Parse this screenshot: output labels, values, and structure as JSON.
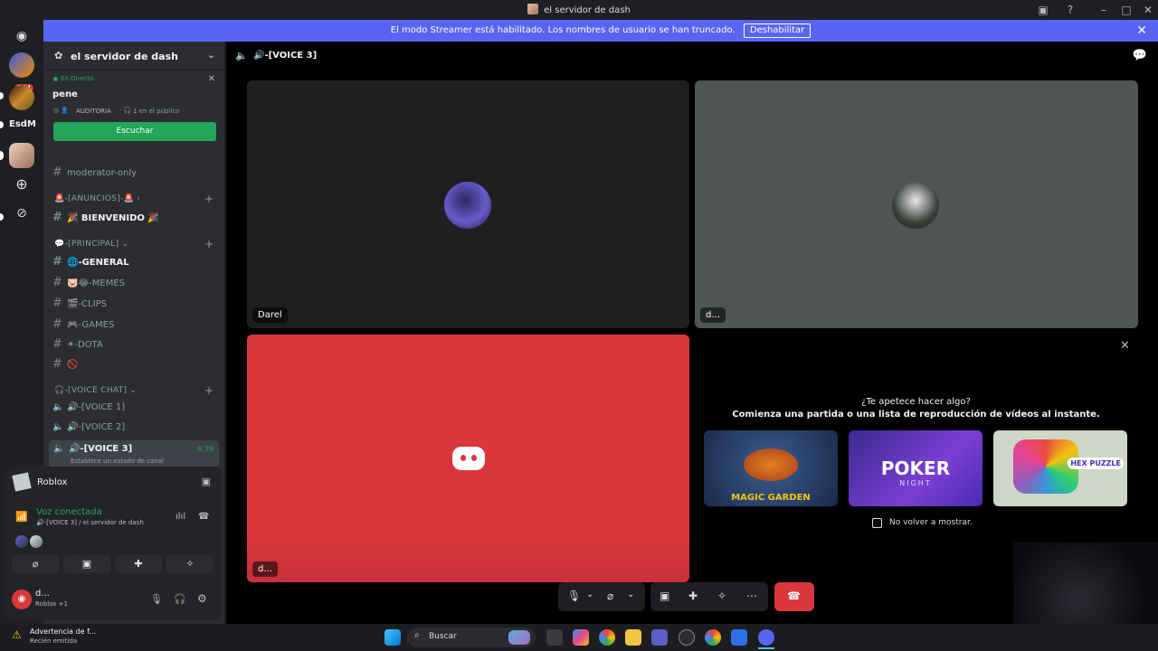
{
  "window": {
    "title": "el servidor de dash"
  },
  "banner": {
    "text": "El modo Streamer está habilitado. Los nombres de usuario se han truncado.",
    "button_label": "Deshabilitar"
  },
  "rail": {
    "badge_count": "544",
    "server_label": "EsdM"
  },
  "server": {
    "name": "el servidor de dash"
  },
  "live": {
    "status": "En Directo",
    "title": "pene",
    "meta": "AUDITORIA",
    "audience": "1 en el público",
    "listen_label": "Escuchar"
  },
  "channels": {
    "moderator": "moderator-only",
    "cat_anuncios": "🚨-[ANUNCIOS]-🚨",
    "bienvenido": "🎉 BIENVENIDO 🎉",
    "cat_principal": "💬-[PRINCIPAL]",
    "general": "🌐-GENERAL",
    "memes": "🐷😂-MEMES",
    "clips": "🎬-CLIPS",
    "games": "🎮-GAMES",
    "dota": "✴-DOTA",
    "unnamed": "🚫",
    "cat_voice": "🎧-[VOICE CHAT]",
    "voice1": "🔊-[VOICE 1]",
    "voice2": "🔊-[VOICE 2]",
    "voice3": "🔊-[VOICE 3]",
    "voice3_time": "6:39",
    "voice3_status": "Establece un estado de canal"
  },
  "panel": {
    "activity": "Roblox",
    "voice_status": "Voz conectada",
    "voice_location": "🔊-[VOICE 3] / el servidor de dash",
    "user_name": "d...",
    "user_activity": "Roblox +1"
  },
  "main": {
    "channel_title": "🔊-[VOICE 3]",
    "tiles": [
      {
        "name": "Darel"
      },
      {
        "name": "d..."
      },
      {
        "name": "d..."
      }
    ],
    "prompt_title": "¿Te apetece hacer algo?",
    "prompt_subtitle": "Comienza una partida o una lista de reproducción de vídeos al instante.",
    "games": [
      {
        "label": "MAGIC GARDEN"
      },
      {
        "label": "POKER",
        "sub": "NIGHT"
      },
      {
        "label": "HEX PUZZLE"
      }
    ],
    "dont_show": "No volver a mostrar."
  },
  "taskbar": {
    "search_placeholder": "Buscar",
    "notif_title": "Advertencia de f...",
    "notif_sub": "Recién emitida"
  },
  "colors": {
    "blurple": "#5865f2",
    "green": "#23a55a",
    "red": "#da373c",
    "tile_dark": "#1f1f22",
    "tile_grey": "#4f5652"
  }
}
